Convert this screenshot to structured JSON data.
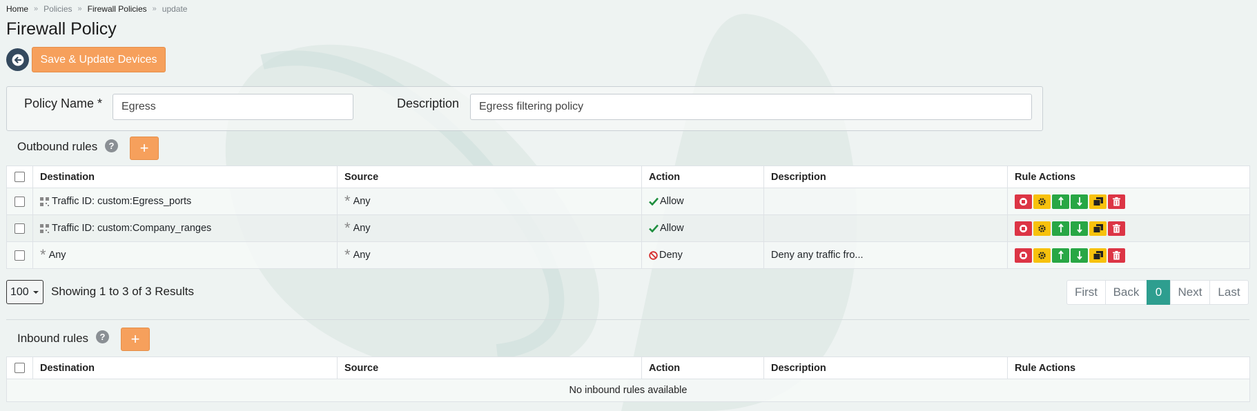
{
  "breadcrumb": {
    "home": "Home",
    "policies": "Policies",
    "firewall": "Firewall Policies",
    "current": "update",
    "separator": "»"
  },
  "page_title": "Firewall Policy",
  "toolbar": {
    "save_label": "Save & Update Devices"
  },
  "form": {
    "policy_name_label": "Policy Name *",
    "policy_name_value": "Egress",
    "description_label": "Description",
    "description_value": "Egress filtering policy"
  },
  "outbound": {
    "label": "Outbound rules",
    "help": "?",
    "add": "+",
    "columns": [
      "Destination",
      "Source",
      "Action",
      "Description",
      "Rule Actions"
    ],
    "rows": [
      {
        "destination": "Traffic ID: custom:Egress_ports",
        "dest_icon": "grid-icon",
        "source": "Any",
        "action": "Allow",
        "action_icon": "check-icon",
        "description": ""
      },
      {
        "destination": "Traffic ID: custom:Company_ranges",
        "dest_icon": "grid-icon",
        "source": "Any",
        "action": "Allow",
        "action_icon": "check-icon",
        "description": ""
      },
      {
        "destination": "Any",
        "dest_icon": "asterisk-icon",
        "source": "Any",
        "action": "Deny",
        "action_icon": "ban-icon",
        "description": "Deny any traffic fro..."
      }
    ]
  },
  "pagination": {
    "page_size": "100",
    "showing": "Showing 1 to 3 of 3 Results",
    "first": "First",
    "back": "Back",
    "current": "0",
    "next": "Next",
    "last": "Last"
  },
  "inbound": {
    "label": "Inbound rules",
    "help": "?",
    "add": "+",
    "columns": [
      "Destination",
      "Source",
      "Action",
      "Description",
      "Rule Actions"
    ],
    "empty": "No inbound rules available"
  },
  "colors": {
    "accent_orange": "#f6a05c",
    "pager_active": "#2e9e8f",
    "danger": "#dc3545",
    "warning": "#f7c10c",
    "success": "#28a745",
    "back_button": "#34495e"
  }
}
